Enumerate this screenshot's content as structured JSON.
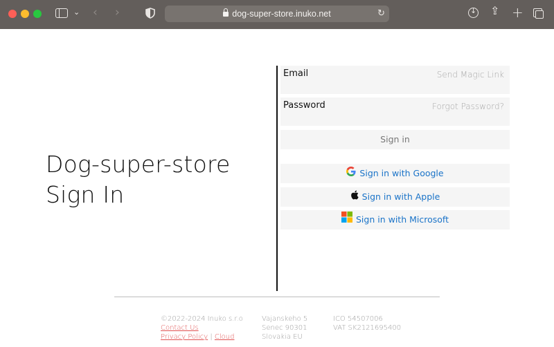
{
  "browser": {
    "url": "dog-super-store.inuko.net"
  },
  "heading": {
    "line1": "Dog-super-store",
    "line2": "Sign In"
  },
  "form": {
    "email_label": "Email",
    "magic_link": "Send Magic Link",
    "password_label": "Password",
    "forgot_password": "Forgot Password?",
    "signin_button": "Sign in",
    "google_button": "Sign in with Google",
    "apple_button": "Sign in with Apple",
    "microsoft_button": "Sign in with Microsoft"
  },
  "footer": {
    "copyright": "©2022-2024 Inuko s.r.o",
    "contact": "Contact Us",
    "privacy": "Privacy Policy",
    "separator": "|",
    "cloud": "Cloud",
    "address1": "Vajanskeho 5",
    "address2": "Senec 90301",
    "address3": "Slovakia EU",
    "ico": "ICO 54507006",
    "vat": "VAT SK2121695400"
  },
  "colors": {
    "chrome": "#635e5b",
    "link": "#1a73c8",
    "footer_link": "#e05050",
    "field_bg": "#f5f5f5"
  }
}
